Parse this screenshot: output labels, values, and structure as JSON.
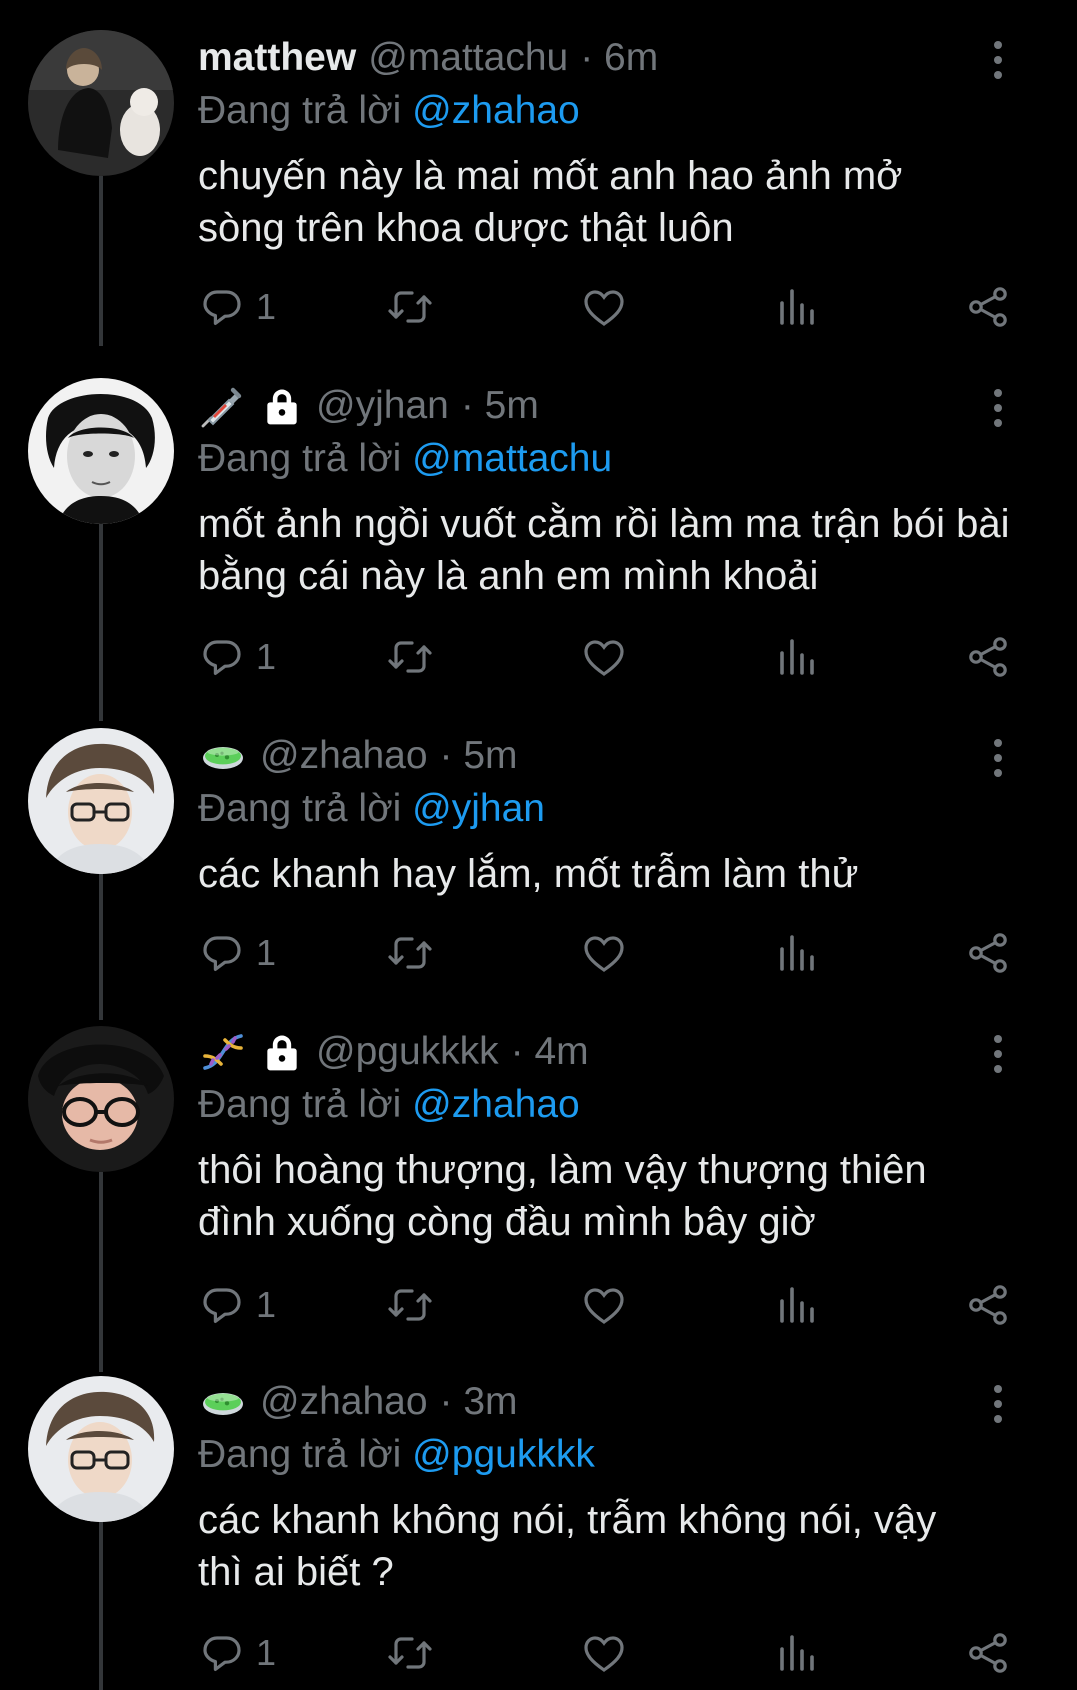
{
  "colors": {
    "background": "#000000",
    "text": "#e7e9ea",
    "muted": "#71767b",
    "link": "#1d9bf0",
    "thread_line": "#333639"
  },
  "tweets": [
    {
      "display_name": "matthew",
      "handle": "@mattachu",
      "time": "· 6m",
      "replying_label": "Đang trả lời",
      "replying_to": "@zhahao",
      "text": "chuyến này là mai mốt anh hao ảnh mở sòng trên khoa dược thật luôn",
      "reply_count": "1",
      "name_emojis": []
    },
    {
      "display_name": "",
      "handle": "@yjhan",
      "time": "· 5m",
      "replying_label": "Đang trả lời",
      "replying_to": "@mattachu",
      "text": "mốt ảnh ngồi vuốt cằm rồi làm ma trận bói bài bằng cái này là anh em mình khoải",
      "reply_count": "1",
      "name_emojis": [
        "syringe-icon",
        "lock-icon"
      ]
    },
    {
      "display_name": "",
      "handle": "@zhahao",
      "time": "· 5m",
      "replying_label": "Đang trả lời",
      "replying_to": "@yjhan",
      "text": "các khanh hay lắm, mốt trẫm làm thử",
      "reply_count": "1",
      "name_emojis": [
        "petri-dish-icon"
      ]
    },
    {
      "display_name": "",
      "handle": "@pgukkkk",
      "time": "· 4m",
      "replying_label": "Đang trả lời",
      "replying_to": "@zhahao",
      "text": "thôi hoàng thượng, làm vậy thượng thiên đình xuống còng đầu mình bây giờ",
      "reply_count": "1",
      "name_emojis": [
        "dna-icon",
        "lock-icon"
      ]
    },
    {
      "display_name": "",
      "handle": "@zhahao",
      "time": "· 3m",
      "replying_label": "Đang trả lời",
      "replying_to": "@pgukkkk",
      "text": "các khanh không nói, trẫm không nói, vậy thì ai biết ?",
      "reply_count": "1",
      "name_emojis": [
        "petri-dish-icon"
      ]
    }
  ]
}
